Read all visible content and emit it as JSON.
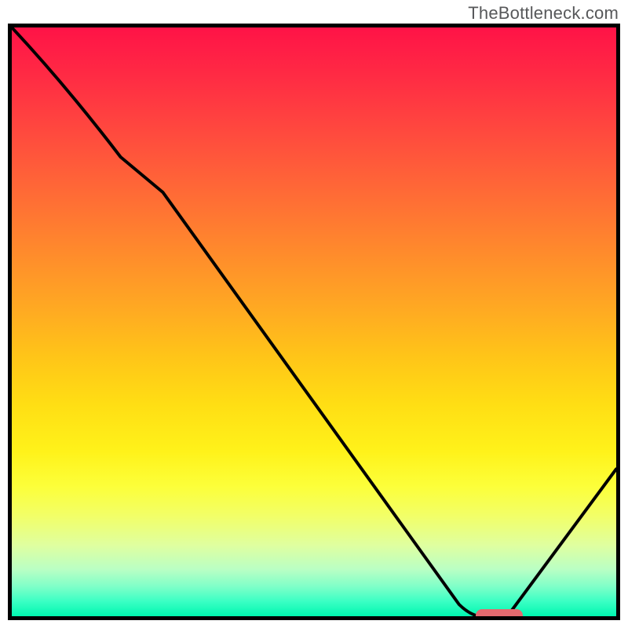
{
  "watermark": "TheBottleneck.com",
  "colors": {
    "pill": "#e46a6f",
    "curve": "#000000"
  },
  "chart_data": {
    "type": "line",
    "title": "",
    "xlabel": "",
    "ylabel": "",
    "xlim": [
      0,
      100
    ],
    "ylim": [
      0,
      100
    ],
    "grid": false,
    "legend": false,
    "background": "red-to-green vertical gradient",
    "series": [
      {
        "name": "curve",
        "x": [
          0,
          18,
          25,
          74,
          79,
          82,
          100
        ],
        "y": [
          100,
          78,
          72,
          2,
          0,
          0,
          25
        ]
      }
    ],
    "marker": {
      "name": "pill",
      "x": 80,
      "y": 0,
      "color": "#e46a6f"
    },
    "notes": "Values are approximate, read from pixel positions; no axis ticks or labels are visible."
  }
}
